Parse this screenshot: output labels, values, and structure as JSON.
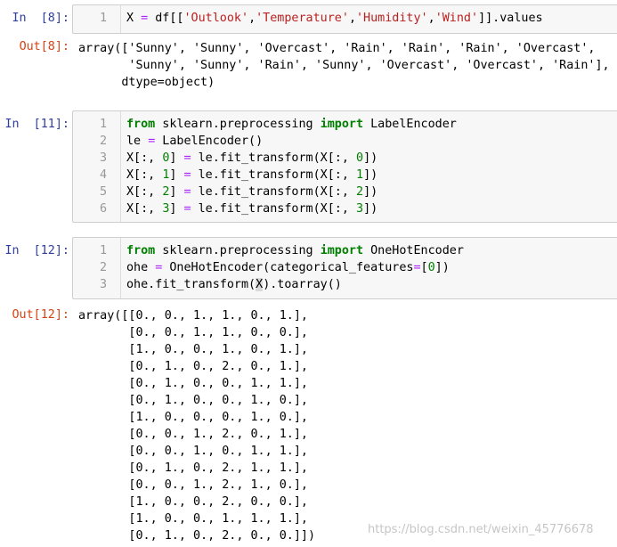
{
  "cells": [
    {
      "prompt": "In  [8]:",
      "out_prompt": "Out[8]:",
      "line_numbers": [
        "1"
      ],
      "code": [
        [
          {
            "t": "X "
          },
          {
            "t": "=",
            "c": "op"
          },
          {
            "t": " df[["
          },
          {
            "t": "'Outlook'",
            "c": "str"
          },
          {
            "t": ","
          },
          {
            "t": "'Temperature'",
            "c": "str"
          },
          {
            "t": ","
          },
          {
            "t": "'Humidity'",
            "c": "str"
          },
          {
            "t": ","
          },
          {
            "t": "'Wind'",
            "c": "str"
          },
          {
            "t": "]].values"
          }
        ]
      ],
      "output": [
        "array(['Sunny', 'Sunny', 'Overcast', 'Rain', 'Rain', 'Rain', 'Overcast',",
        "       'Sunny', 'Sunny', 'Rain', 'Sunny', 'Overcast', 'Overcast', 'Rain'],",
        "      dtype=object)"
      ]
    },
    {
      "prompt": "In  [11]:",
      "line_numbers": [
        "1",
        "2",
        "3",
        "4",
        "5",
        "6"
      ],
      "code": [
        [
          {
            "t": "from",
            "c": "kw"
          },
          {
            "t": " sklearn.preprocessing "
          },
          {
            "t": "import",
            "c": "kw"
          },
          {
            "t": " LabelEncoder"
          }
        ],
        [
          {
            "t": "le "
          },
          {
            "t": "=",
            "c": "op"
          },
          {
            "t": " LabelEncoder()"
          }
        ],
        [
          {
            "t": "X[:, "
          },
          {
            "t": "0",
            "c": "num"
          },
          {
            "t": "] "
          },
          {
            "t": "=",
            "c": "op"
          },
          {
            "t": " le.fit_transform(X[:, "
          },
          {
            "t": "0",
            "c": "num"
          },
          {
            "t": "])"
          }
        ],
        [
          {
            "t": "X[:, "
          },
          {
            "t": "1",
            "c": "num"
          },
          {
            "t": "] "
          },
          {
            "t": "=",
            "c": "op"
          },
          {
            "t": " le.fit_transform(X[:, "
          },
          {
            "t": "1",
            "c": "num"
          },
          {
            "t": "])"
          }
        ],
        [
          {
            "t": "X[:, "
          },
          {
            "t": "2",
            "c": "num"
          },
          {
            "t": "] "
          },
          {
            "t": "=",
            "c": "op"
          },
          {
            "t": " le.fit_transform(X[:, "
          },
          {
            "t": "2",
            "c": "num"
          },
          {
            "t": "])"
          }
        ],
        [
          {
            "t": "X[:, "
          },
          {
            "t": "3",
            "c": "num"
          },
          {
            "t": "] "
          },
          {
            "t": "=",
            "c": "op"
          },
          {
            "t": " le.fit_transform(X[:, "
          },
          {
            "t": "3",
            "c": "num"
          },
          {
            "t": "])"
          }
        ]
      ]
    },
    {
      "prompt": "In  [12]:",
      "out_prompt": "Out[12]:",
      "line_numbers": [
        "1",
        "2",
        "3"
      ],
      "code": [
        [
          {
            "t": "from",
            "c": "kw"
          },
          {
            "t": " sklearn.preprocessing "
          },
          {
            "t": "import",
            "c": "kw"
          },
          {
            "t": " OneHotEncoder"
          }
        ],
        [
          {
            "t": "ohe "
          },
          {
            "t": "=",
            "c": "op"
          },
          {
            "t": " OneHotEncoder(categorical_features"
          },
          {
            "t": "=",
            "c": "op"
          },
          {
            "t": "["
          },
          {
            "t": "0",
            "c": "num"
          },
          {
            "t": "])"
          }
        ],
        [
          {
            "t": "ohe.fit_transform("
          },
          {
            "t": "X",
            "c": "hl"
          },
          {
            "t": ").toarray()"
          }
        ]
      ],
      "output": [
        "array([[0., 0., 1., 1., 0., 1.],",
        "       [0., 0., 1., 1., 0., 0.],",
        "       [1., 0., 0., 1., 0., 1.],",
        "       [0., 1., 0., 2., 0., 1.],",
        "       [0., 1., 0., 0., 1., 1.],",
        "       [0., 1., 0., 0., 1., 0.],",
        "       [1., 0., 0., 0., 1., 0.],",
        "       [0., 0., 1., 2., 0., 1.],",
        "       [0., 0., 1., 0., 1., 1.],",
        "       [0., 1., 0., 2., 1., 1.],",
        "       [0., 0., 1., 2., 1., 0.],",
        "       [1., 0., 0., 2., 0., 0.],",
        "       [1., 0., 0., 1., 1., 1.],",
        "       [0., 1., 0., 2., 0., 0.]])"
      ]
    }
  ],
  "watermark": "https://blog.csdn.net/weixin_45776678",
  "colors": {
    "in_prompt": "#303f9f",
    "out_prompt": "#d84315",
    "keyword": "#008000",
    "string": "#ba2121",
    "operator": "#aa22ff",
    "number": "#008000",
    "cell_background": "#f7f7f7"
  }
}
